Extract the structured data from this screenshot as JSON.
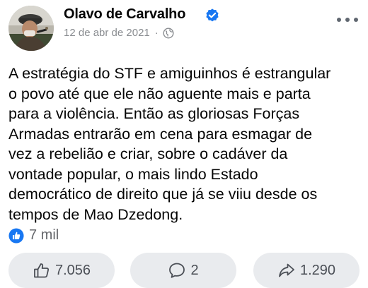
{
  "post": {
    "author": "Olavo de Carvalho",
    "date": "12 de abr de 2021",
    "separator": "·",
    "audience_icon": "globe-icon",
    "verified_icon": "verified-badge-icon",
    "more_icon": "more-options-icon",
    "text_lines": [
      "A estratégia do STF e amiguinhos é estrangular",
      "o povo até que ele não aguente mais e parta",
      "para a violência. Então as gloriosas Forças",
      "Armadas entrarão em cena para esmagar de",
      "vez a rebelião e criar, sobre o cadáver da",
      "vontade popular, o mais lindo Estado",
      "democrático de direito que já se viiu desde os",
      "tempos de Mao Dzedong."
    ]
  },
  "reactions": {
    "icon": "like-reaction-icon",
    "count": "7 mil"
  },
  "actions": {
    "like": {
      "icon": "thumbs-up-icon",
      "count": "7.056"
    },
    "comment": {
      "icon": "comment-bubble-icon",
      "count": "2"
    },
    "share": {
      "icon": "share-arrow-icon",
      "count": "1.290"
    }
  },
  "colors": {
    "verified_blue": "#1877f2",
    "meta_gray": "#8a8d91",
    "button_bg": "#e9ebee",
    "text": "#050505"
  }
}
